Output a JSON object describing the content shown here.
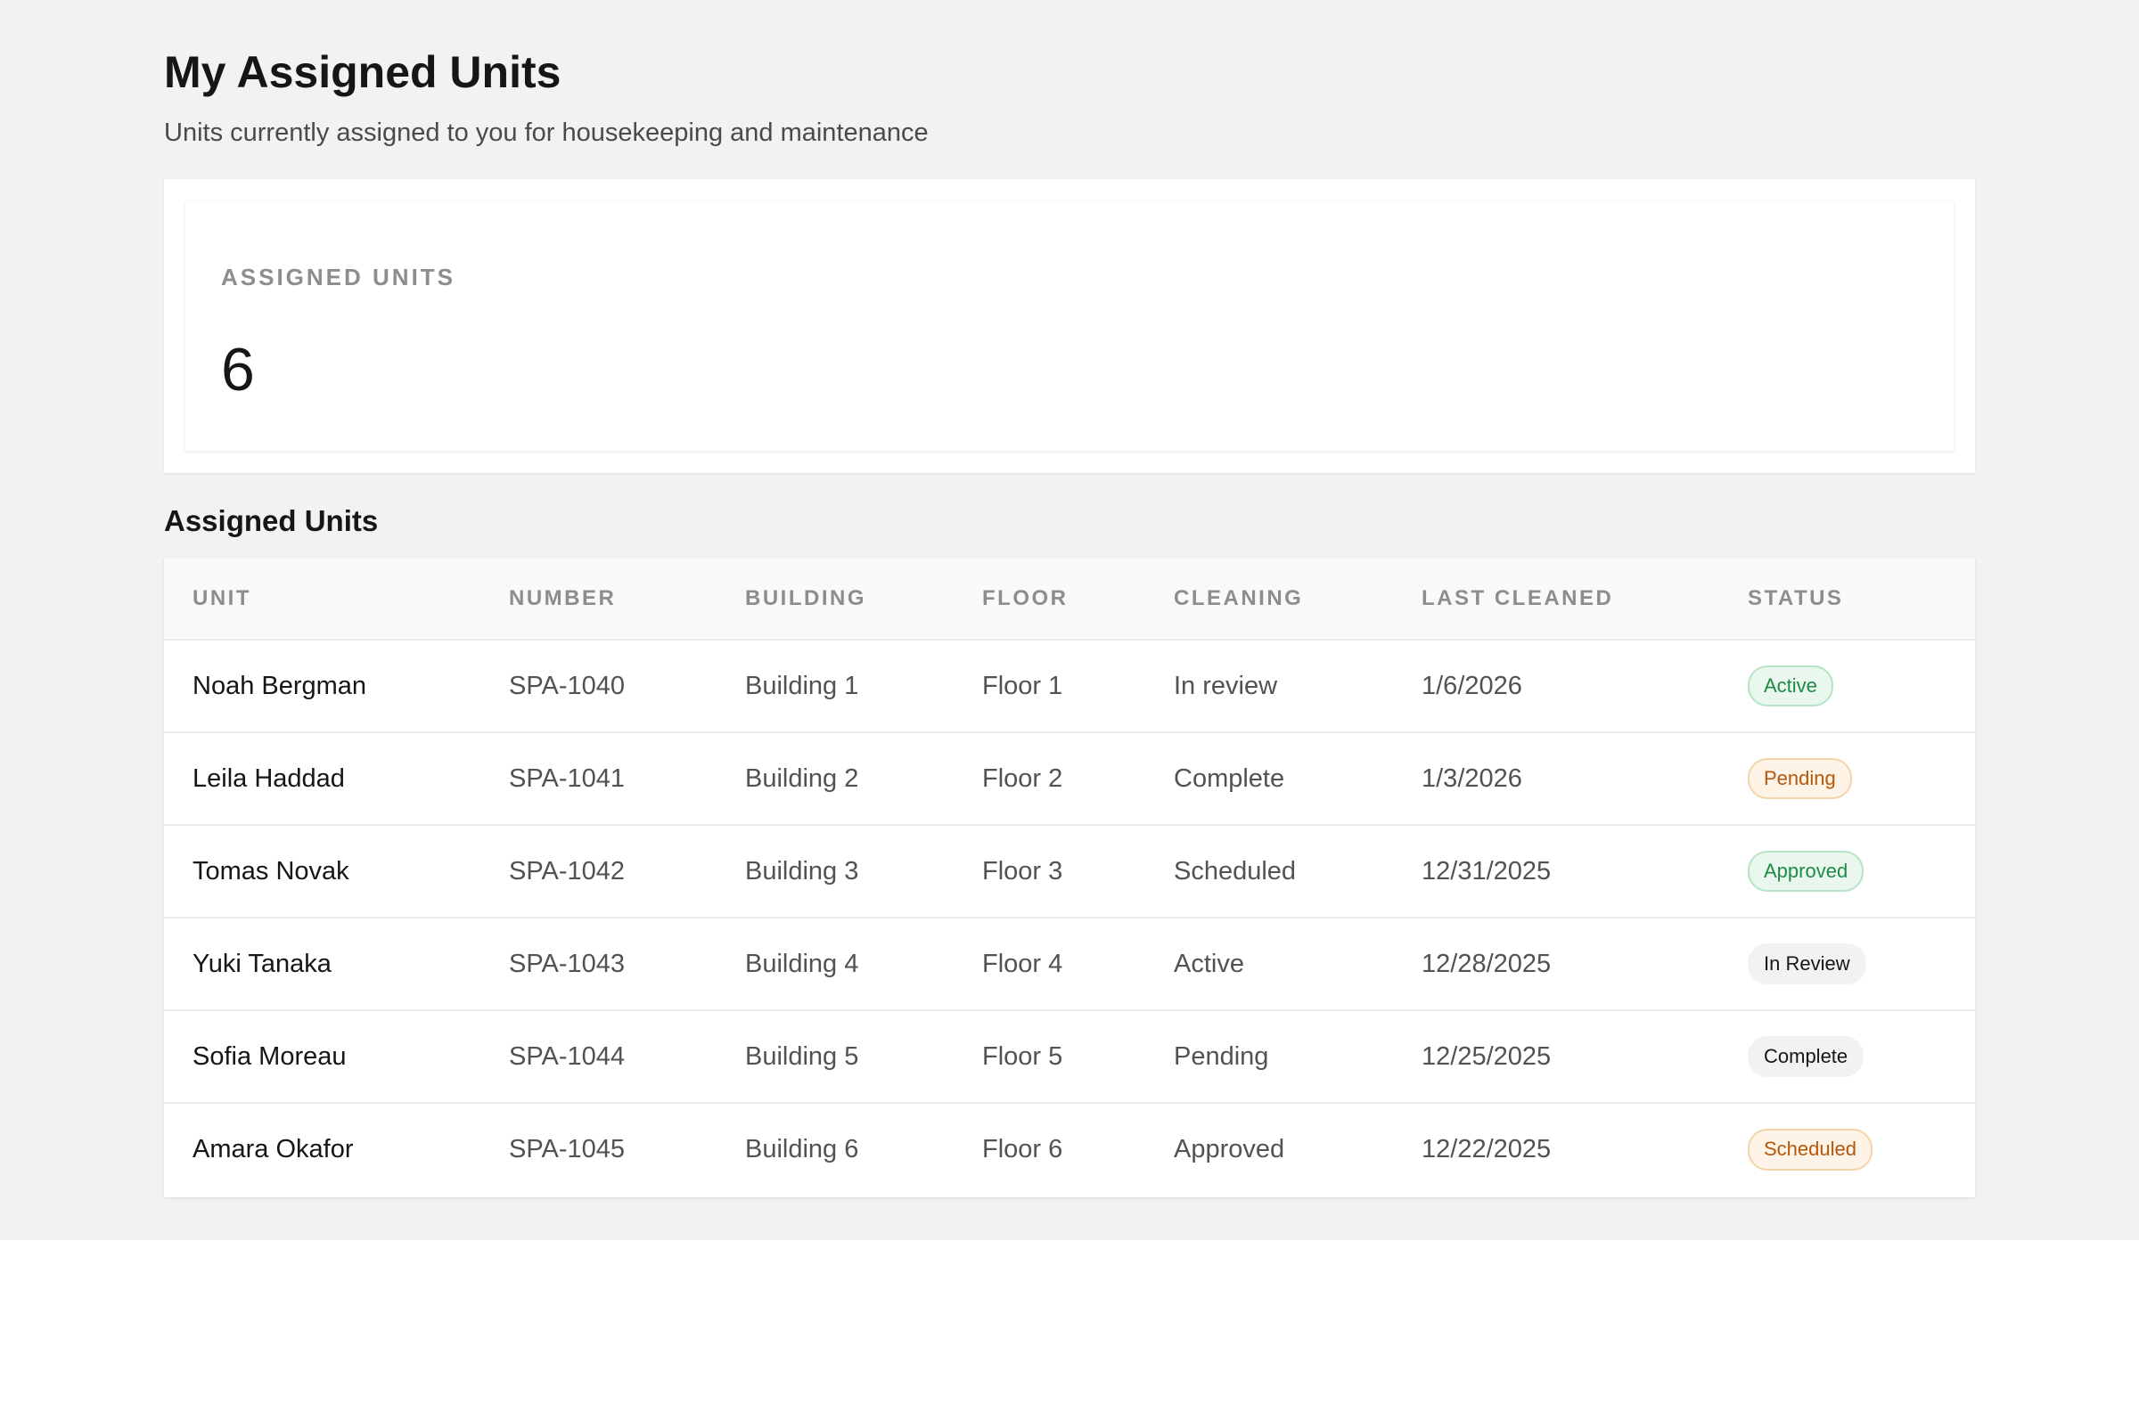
{
  "header": {
    "title": "My Assigned Units",
    "subtitle": "Units currently assigned to you for housekeeping and maintenance"
  },
  "stat": {
    "label": "ASSIGNED UNITS",
    "value": "6"
  },
  "table": {
    "title": "Assigned Units",
    "columns": [
      "UNIT",
      "NUMBER",
      "BUILDING",
      "FLOOR",
      "CLEANING",
      "LAST CLEANED",
      "STATUS"
    ],
    "rows": [
      {
        "unit": "Noah Bergman",
        "number": "SPA-1040",
        "building": "Building 1",
        "floor": "Floor 1",
        "cleaning": "In review",
        "last_cleaned": "1/6/2026",
        "status": "Active",
        "status_color": "#1f8a46"
      },
      {
        "unit": "Leila Haddad",
        "number": "SPA-1041",
        "building": "Building 2",
        "floor": "Floor 2",
        "cleaning": "Complete",
        "last_cleaned": "1/3/2026",
        "status": "Pending",
        "status_color": "#b5570b"
      },
      {
        "unit": "Tomas Novak",
        "number": "SPA-1042",
        "building": "Building 3",
        "floor": "Floor 3",
        "cleaning": "Scheduled",
        "last_cleaned": "12/31/2025",
        "status": "Approved",
        "status_color": "#1f8a46"
      },
      {
        "unit": "Yuki Tanaka",
        "number": "SPA-1043",
        "building": "Building 4",
        "floor": "Floor 4",
        "cleaning": "Active",
        "last_cleaned": "12/28/2025",
        "status": "In Review",
        "status_color": "#161616"
      },
      {
        "unit": "Sofia Moreau",
        "number": "SPA-1044",
        "building": "Building 5",
        "floor": "Floor 5",
        "cleaning": "Pending",
        "last_cleaned": "12/25/2025",
        "status": "Complete",
        "status_color": "#161616"
      },
      {
        "unit": "Amara Okafor",
        "number": "SPA-1045",
        "building": "Building 6",
        "floor": "Floor 6",
        "cleaning": "Approved",
        "last_cleaned": "12/22/2025",
        "status": "Scheduled",
        "status_color": "#b5570b"
      }
    ]
  }
}
